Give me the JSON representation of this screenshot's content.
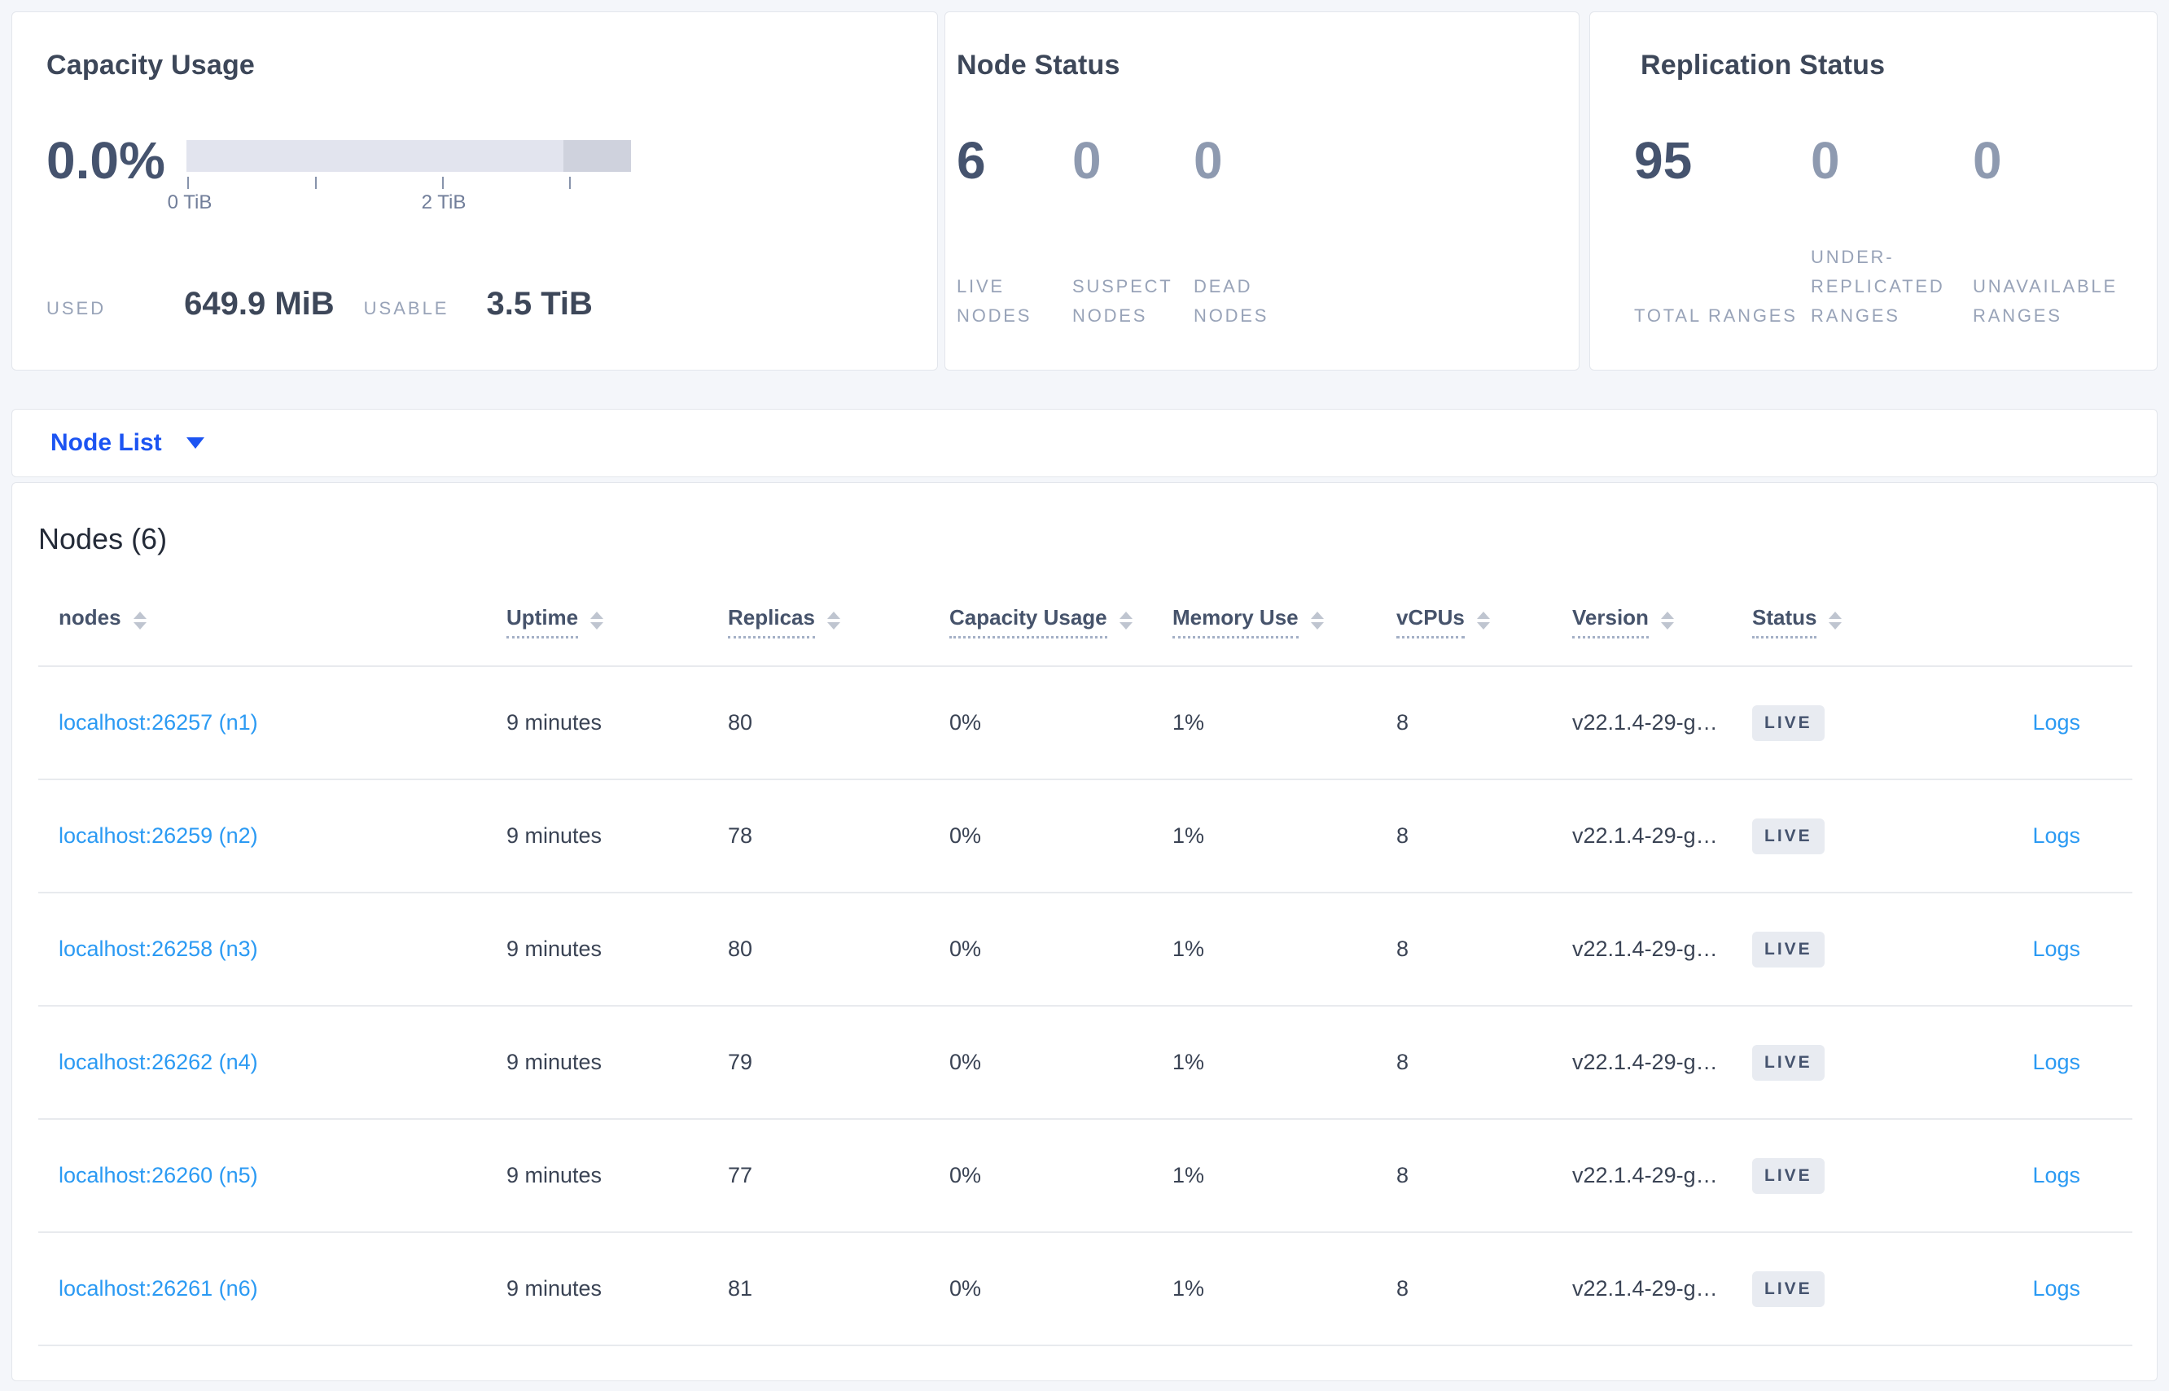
{
  "summary": {
    "capacity": {
      "title": "Capacity Usage",
      "percent": "0.0%",
      "axis": {
        "tick_label_0": "0 TiB",
        "tick_label_2": "2 TiB"
      },
      "used_label": "USED",
      "used_value": "649.9 MiB",
      "usable_label": "USABLE",
      "usable_value": "3.5 TiB"
    },
    "node_status": {
      "title": "Node Status",
      "metrics": [
        {
          "value": "6",
          "label": "LIVE NODES"
        },
        {
          "value": "0",
          "label": "SUSPECT NODES"
        },
        {
          "value": "0",
          "label": "DEAD NODES"
        }
      ]
    },
    "replication": {
      "title": "Replication Status",
      "metrics": [
        {
          "value": "95",
          "label": "TOTAL RANGES"
        },
        {
          "value": "0",
          "label": "UNDER-REPLICATED RANGES"
        },
        {
          "value": "0",
          "label": "UNAVAILABLE RANGES"
        }
      ]
    }
  },
  "node_list_bar": {
    "label": "Node List"
  },
  "nodes": {
    "title": "Nodes (6)",
    "columns": [
      "nodes",
      "Uptime",
      "Replicas",
      "Capacity Usage",
      "Memory Use",
      "vCPUs",
      "Version",
      "Status"
    ],
    "rows": [
      {
        "address": "localhost:26257 (n1)",
        "uptime": "9 minutes",
        "replicas": "80",
        "capacity": "0%",
        "memory": "1%",
        "vcpus": "8",
        "version": "v22.1.4-29-g…",
        "status": "LIVE",
        "logs": "Logs"
      },
      {
        "address": "localhost:26259 (n2)",
        "uptime": "9 minutes",
        "replicas": "78",
        "capacity": "0%",
        "memory": "1%",
        "vcpus": "8",
        "version": "v22.1.4-29-g…",
        "status": "LIVE",
        "logs": "Logs"
      },
      {
        "address": "localhost:26258 (n3)",
        "uptime": "9 minutes",
        "replicas": "80",
        "capacity": "0%",
        "memory": "1%",
        "vcpus": "8",
        "version": "v22.1.4-29-g…",
        "status": "LIVE",
        "logs": "Logs"
      },
      {
        "address": "localhost:26262 (n4)",
        "uptime": "9 minutes",
        "replicas": "79",
        "capacity": "0%",
        "memory": "1%",
        "vcpus": "8",
        "version": "v22.1.4-29-g…",
        "status": "LIVE",
        "logs": "Logs"
      },
      {
        "address": "localhost:26260 (n5)",
        "uptime": "9 minutes",
        "replicas": "77",
        "capacity": "0%",
        "memory": "1%",
        "vcpus": "8",
        "version": "v22.1.4-29-g…",
        "status": "LIVE",
        "logs": "Logs"
      },
      {
        "address": "localhost:26261 (n6)",
        "uptime": "9 minutes",
        "replicas": "81",
        "capacity": "0%",
        "memory": "1%",
        "vcpus": "8",
        "version": "v22.1.4-29-g…",
        "status": "LIVE",
        "logs": "Logs"
      }
    ]
  },
  "colors": {
    "accent_blue": "#1c54f2",
    "link_blue": "#2b9af3",
    "number_dark": "#45536e",
    "number_light": "#8e9ab0",
    "muted_label": "#98a3b8",
    "badge_bg": "#e8ebf1",
    "bar_light": "#e2e4ee",
    "bar_dark": "#cfd2dd",
    "page_bg": "#f4f6fa"
  }
}
